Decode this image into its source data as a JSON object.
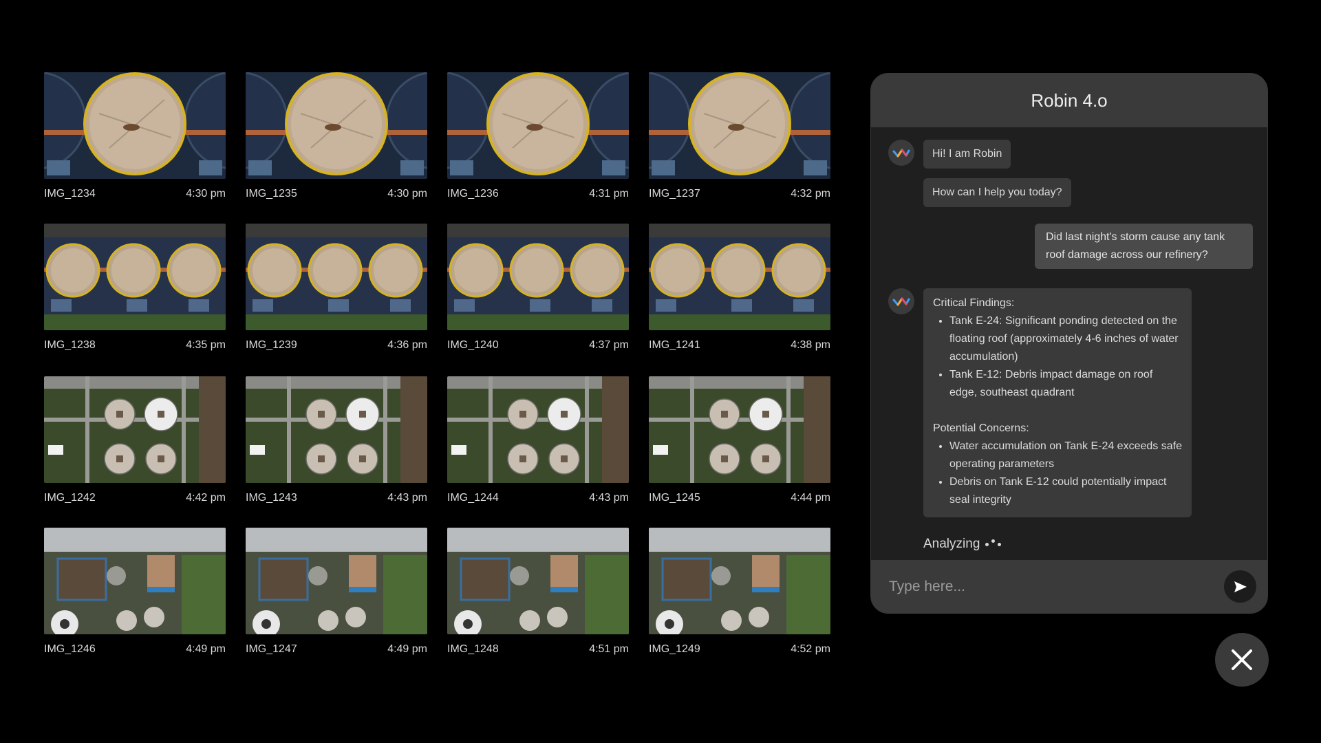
{
  "gallery": {
    "images": [
      {
        "name": "IMG_1234",
        "time": "4:30 pm",
        "kind": "tank-single"
      },
      {
        "name": "IMG_1235",
        "time": "4:30 pm",
        "kind": "tank-single"
      },
      {
        "name": "IMG_1236",
        "time": "4:31 pm",
        "kind": "tank-single"
      },
      {
        "name": "IMG_1237",
        "time": "4:32 pm",
        "kind": "tank-single"
      },
      {
        "name": "IMG_1238",
        "time": "4:35 pm",
        "kind": "tank-row"
      },
      {
        "name": "IMG_1239",
        "time": "4:36 pm",
        "kind": "tank-row"
      },
      {
        "name": "IMG_1240",
        "time": "4:37 pm",
        "kind": "tank-row"
      },
      {
        "name": "IMG_1241",
        "time": "4:38 pm",
        "kind": "tank-row"
      },
      {
        "name": "IMG_1242",
        "time": "4:42 pm",
        "kind": "sphere-grid"
      },
      {
        "name": "IMG_1243",
        "time": "4:43 pm",
        "kind": "sphere-grid"
      },
      {
        "name": "IMG_1244",
        "time": "4:43 pm",
        "kind": "sphere-grid"
      },
      {
        "name": "IMG_1245",
        "time": "4:44 pm",
        "kind": "sphere-grid"
      },
      {
        "name": "IMG_1246",
        "time": "4:49 pm",
        "kind": "plant"
      },
      {
        "name": "IMG_1247",
        "time": "4:49 pm",
        "kind": "plant"
      },
      {
        "name": "IMG_1248",
        "time": "4:51 pm",
        "kind": "plant"
      },
      {
        "name": "IMG_1249",
        "time": "4:52 pm",
        "kind": "plant"
      }
    ]
  },
  "chat": {
    "title": "Robin 4.o",
    "bot_greeting_1": "Hi! I am Robin",
    "bot_greeting_2": "How can I help you today?",
    "user_question": "Did last night's storm cause any tank roof damage across our refinery?",
    "response": {
      "critical_title": "Critical Findings:",
      "critical": [
        "Tank E-24: Significant ponding detected on the floating roof (approximately 4-6 inches of water accumulation)",
        "Tank E-12: Debris impact damage on roof edge, southeast quadrant"
      ],
      "concerns_title": "Potential Concerns:",
      "concerns": [
        "Water accumulation on Tank E-24 exceeds safe operating parameters",
        "Debris on Tank E-12 could potentially impact seal integrity"
      ]
    },
    "status": "Analyzing",
    "input_placeholder": "Type here...",
    "input_value": ""
  },
  "icons": {
    "avatar": "robin-logo-icon",
    "send": "send-icon",
    "close": "close-icon"
  },
  "colors": {
    "background": "#000000",
    "panel": "#1f1f1f",
    "header": "#3a3a3a",
    "bubble": "#3a3a3a",
    "tank_ring": "#d6b323"
  }
}
